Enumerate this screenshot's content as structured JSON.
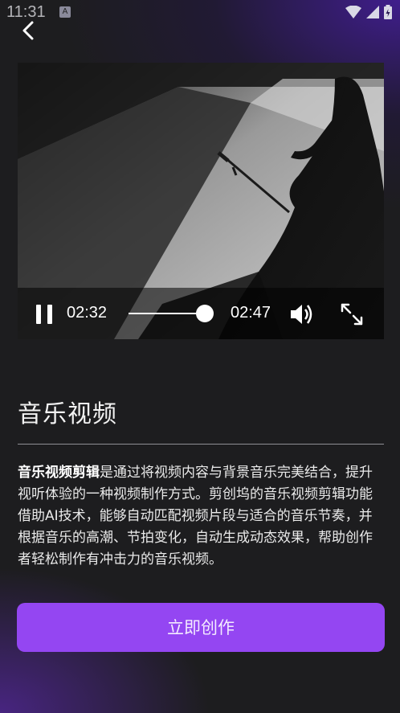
{
  "status_bar": {
    "time": "11:31",
    "notification_badge": "A"
  },
  "video": {
    "current_time": "02:32",
    "duration": "02:47",
    "progress": 0.91
  },
  "title": "音乐视频",
  "description": {
    "highlight": "音乐视频剪辑",
    "body": "是通过将视频内容与背景音乐完美结合，提升视听体验的一种视频制作方式。剪创坞的音乐视频剪辑功能借助AI技术，能够自动匹配视频片段与适合的音乐节奏，并根据音乐的高潮、节拍变化，自动生成动态效果，帮助创作者轻松制作有冲击力的音乐视频。"
  },
  "create_button_label": "立即创作",
  "colors": {
    "accent": "#9446f2",
    "background": "#1d1d1f"
  }
}
